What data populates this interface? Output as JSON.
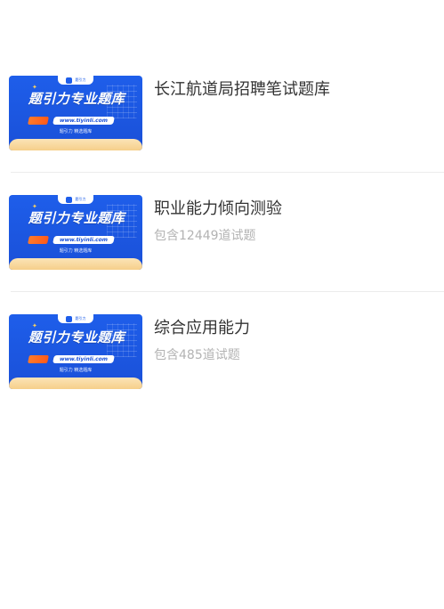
{
  "items": [
    {
      "title": "长江航道局招聘笔试题库",
      "count": "",
      "thumb": {
        "brand": "题引力",
        "title": "题引力专业题库",
        "site": "www.tiyinli.com",
        "subtitle": "题引力 精选题库",
        "star_icon": "star-icon",
        "logo_icon": "tiyinli-logo-icon"
      }
    },
    {
      "title": "职业能力倾向测验",
      "count": "包含12449道试题",
      "thumb": {
        "brand": "题引力",
        "title": "题引力专业题库",
        "site": "www.tiyinli.com",
        "subtitle": "题引力 精选题库",
        "star_icon": "star-icon",
        "logo_icon": "tiyinli-logo-icon"
      }
    },
    {
      "title": "综合应用能力",
      "count": "包含485道试题",
      "thumb": {
        "brand": "题引力",
        "title": "题引力专业题库",
        "site": "www.tiyinli.com",
        "subtitle": "题引力 精选题库",
        "star_icon": "star-icon",
        "logo_icon": "tiyinli-logo-icon"
      }
    }
  ],
  "colors": {
    "thumb_blue": "#1e5eea",
    "thumb_gold": "#f6cf8a",
    "title_text": "#333333",
    "count_text": "#b3b3b3",
    "divider": "#ececec"
  }
}
